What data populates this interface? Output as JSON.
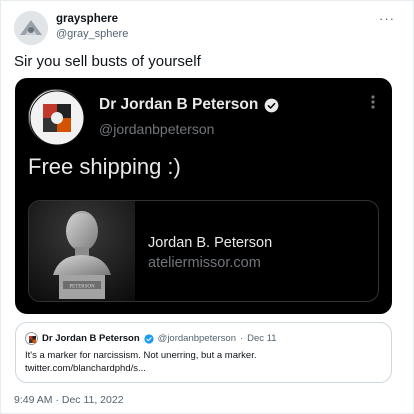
{
  "author": {
    "display_name": "graysphere",
    "handle": "@gray_sphere"
  },
  "tweet": {
    "text": "Sir you sell busts of yourself",
    "more_label": "···",
    "timestamp": "9:49 AM · Dec 11, 2022"
  },
  "media": {
    "display_name": "Dr Jordan B Peterson",
    "handle": "@jordanbpeterson",
    "text": "Free shipping :)",
    "more_label": "⋮",
    "card": {
      "title": "Jordan B. Peterson",
      "domain": "ateliermissor.com",
      "plaque_text": "PETERSON"
    }
  },
  "quote": {
    "display_name": "Dr Jordan B Peterson",
    "handle": "@jordanbpeterson",
    "separator": "·",
    "date": "Dec 11",
    "line1": "It's a marker for narcissism. Not unerring, but a marker.",
    "line2": "twitter.com/blanchardphd/s..."
  },
  "colors": {
    "verified": "#1d9bf0",
    "text_secondary": "#536471",
    "media_bg": "#000000"
  }
}
